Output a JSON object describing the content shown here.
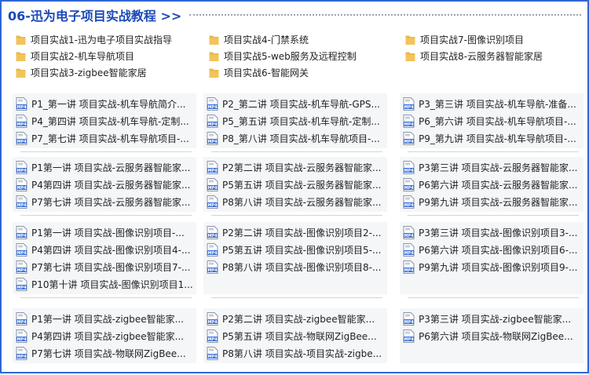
{
  "header": {
    "title": "06-迅为电子项目实战教程 >>"
  },
  "folders": [
    [
      "项目实战1-迅为电子项目实战指导",
      "项目实战2-机车导航项目",
      "项目实战3-zigbee智能家居"
    ],
    [
      "项目实战4-门禁系统",
      "项目实战5-web服务及远程控制",
      "项目实战6-智能网关"
    ],
    [
      "项目实战7-图像识别项目",
      "项目实战8-云服务器智能家居"
    ]
  ],
  "file_groups": [
    {
      "columns": [
        [
          "P1_第一讲 项目实战-机车导航简介...",
          "P4_第四讲 项目实战-机车导航-定制...",
          "P7_第七讲 项目实战-机车导航项目-..."
        ],
        [
          "P2_第二讲 项目实战-机车导航-GPS...",
          "P5_第五讲 项目实战-机车导航-定制...",
          "P8_第八讲 项目实战-机车导航项目-..."
        ],
        [
          "P3_第三讲 项目实战-机车导航-准备...",
          "P6_第六讲 项目实战-机车导航项目-...",
          "P9_第九讲 项目实战-机车导航项目-..."
        ]
      ]
    },
    {
      "columns": [
        [
          "P1第一讲 项目实战-云服务器智能家...",
          "P4第四讲 项目实战-云服务器智能家...",
          "P7第七讲 项目实战-云服务器智能家..."
        ],
        [
          "P2第二讲 项目实战-云服务器智能家...",
          "P5第五讲 项目实战-云服务器智能家...",
          "P8第八讲 项目实战-云服务器智能家..."
        ],
        [
          "P3第三讲 项目实战-云服务器智能家...",
          "P6第六讲 项目实战-云服务器智能家...",
          "P9第九讲 项目实战-云服务器智能家..."
        ]
      ]
    },
    {
      "columns": [
        [
          "P1第一讲 项目实战-图像识别项目-...",
          "P4第四讲 项目实战-图像识别项目4-...",
          "P7第七讲 项目实战-图像识别项目7-...",
          "P10第十讲 项目实战-图像识别项目1..."
        ],
        [
          "P2第二讲 项目实战-图像识别项目2-...",
          "P5第五讲 项目实战-图像识别项目5-...",
          "P8第八讲 项目实战-图像识别项目8-..."
        ],
        [
          "P3第三讲 项目实战-图像识别项目3-...",
          "P6第六讲 项目实战-图像识别项目6-...",
          "P9第九讲 项目实战-图像识别项目9-..."
        ]
      ]
    },
    {
      "columns": [
        [
          "P1第一讲 项目实战-zigbee智能家...",
          "P4第四讲 项目实战-zigbee智能家...",
          "P7第七讲 项目实战-物联网ZigBee..."
        ],
        [
          "P2第二讲 项目实战-zigbee智能家...",
          "P5第五讲 项目实战-物联网ZigBee...",
          "P8第八讲 项目实战-项目实战-zigbe..."
        ],
        [
          "P3第三讲 项目实战-zigbee智能家...",
          "P6第六讲 项目实战-物联网ZigBee..."
        ]
      ]
    }
  ],
  "icons": {
    "folder": "folder-icon",
    "video": "mp4-file-icon",
    "video_badge": "MP4"
  },
  "colors": {
    "border": "#2f66d6",
    "title": "#1b49b8",
    "folder": "#f2c45a",
    "mp4_badge": "#3a6fd8"
  }
}
